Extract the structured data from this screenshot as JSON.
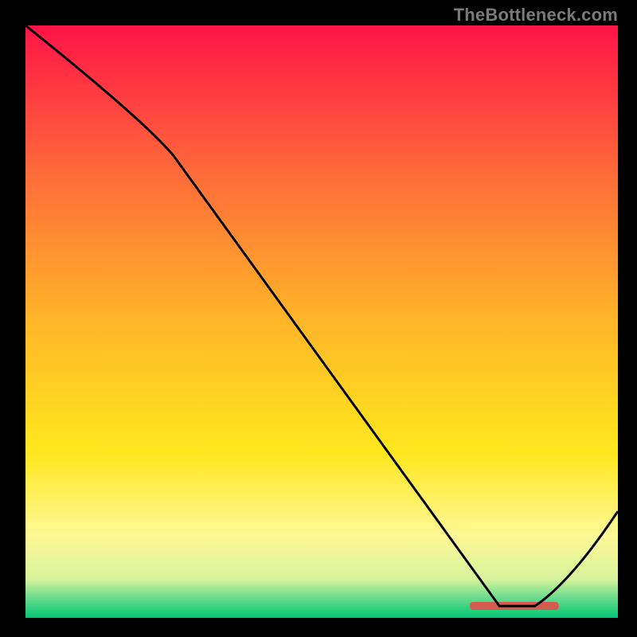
{
  "attribution": "TheBottleneck.com",
  "chart_data": {
    "type": "line",
    "title": "",
    "xlabel": "",
    "ylabel": "",
    "xlim": [
      0,
      100
    ],
    "ylim": [
      0,
      100
    ],
    "x": [
      0,
      25,
      80,
      86,
      100
    ],
    "values": [
      100,
      78,
      2,
      2,
      18
    ],
    "optimal_band": {
      "x_start": 75,
      "x_end": 90,
      "color": "#d55a4f"
    },
    "background_gradient_stops": [
      {
        "offset": 0.0,
        "color": "#ff1447"
      },
      {
        "offset": 0.25,
        "color": "#ff6b3a"
      },
      {
        "offset": 0.5,
        "color": "#ffb628"
      },
      {
        "offset": 0.72,
        "color": "#ffe71e"
      },
      {
        "offset": 0.86,
        "color": "#fff896"
      },
      {
        "offset": 0.935,
        "color": "#d6f39b"
      },
      {
        "offset": 0.965,
        "color": "#6edc8f"
      },
      {
        "offset": 1.0,
        "color": "#00c672"
      }
    ]
  }
}
